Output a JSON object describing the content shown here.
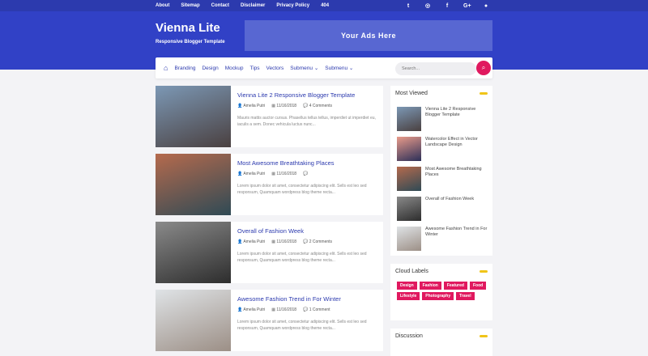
{
  "topnav": [
    "About",
    "Sitemap",
    "Contact",
    "Disclaimer",
    "Privacy Policy",
    "404"
  ],
  "social_icons": [
    {
      "name": "twitter-icon",
      "glyph": "t"
    },
    {
      "name": "instagram-icon",
      "glyph": "◎"
    },
    {
      "name": "facebook-icon",
      "glyph": "f"
    },
    {
      "name": "google-plus-icon",
      "glyph": "G+"
    },
    {
      "name": "snapchat-icon",
      "glyph": "●"
    }
  ],
  "brand": {
    "title": "Vienna Lite",
    "tagline": "Responsive Blogger Template"
  },
  "ads": {
    "label": "Your Ads Here"
  },
  "menu": {
    "home_icon": "⌂",
    "items": [
      "Branding",
      "Design",
      "Mockup",
      "Tips",
      "Vectors",
      "Submenu ⌄",
      "Submenu ⌄"
    ]
  },
  "search": {
    "placeholder": "Search..."
  },
  "posts": [
    {
      "title": "Vienna Lite 2 Responsive Blogger Template",
      "author": "Amelia Putri",
      "date": "11/16/2018",
      "comments": "4 Comments",
      "excerpt": "Mauris mattis auctor cursus. Phasellus tellus tellus, imperdiet ut imperdiet eu, iaculis a sem. Donec vehicula luctus nunc...",
      "colors": [
        "#7c98b5",
        "#4a4040"
      ]
    },
    {
      "title": "Most Awesome Breathtaking Places",
      "author": "Amelia Putri",
      "date": "11/16/2018",
      "comments": "",
      "excerpt": "Lorem ipsum dolor sit amet, consectetur adipiscing elit. Sells est leo sed responsum, Quamquam wordpress blog theme recta...",
      "colors": [
        "#b56a4d",
        "#2f4a55"
      ]
    },
    {
      "title": "Overall of Fashion Week",
      "author": "Amelia Putri",
      "date": "11/16/2018",
      "comments": "2 Comments",
      "excerpt": "Lorem ipsum dolor sit amet, consectetur adipiscing elit. Sells est leo sed responsum, Quamquam wordpress blog theme recta...",
      "colors": [
        "#8a8a8a",
        "#2d2d2d"
      ]
    },
    {
      "title": "Awesome Fashion Trend in For Winter",
      "author": "Amelia Putri",
      "date": "11/16/2018",
      "comments": "1 Comment",
      "excerpt": "Lorem ipsum dolor sit amet, consectetur adipiscing elit. Sells est leo sed responsum, Quamquam wordpress blog theme recta...",
      "colors": [
        "#dfe3e6",
        "#9c8f86"
      ]
    }
  ],
  "most_viewed": {
    "title": "Most Viewed",
    "items": [
      {
        "title": "Vienna Lite 2 Responsive Blogger Template",
        "colors": [
          "#7c98b5",
          "#4a4040"
        ]
      },
      {
        "title": "Watercolor Effect in Vector Landscape Design",
        "colors": [
          "#e99b8a",
          "#2b2f58"
        ]
      },
      {
        "title": "Most Awesome Breathtaking Places",
        "colors": [
          "#b56a4d",
          "#2f4a55"
        ]
      },
      {
        "title": "Overall of Fashion Week",
        "colors": [
          "#8a8a8a",
          "#2d2d2d"
        ]
      },
      {
        "title": "Awesome Fashion Trend in For Winter",
        "colors": [
          "#dfe3e6",
          "#9c8f86"
        ]
      }
    ]
  },
  "cloud_labels": {
    "title": "Cloud Labels",
    "labels": [
      "Design",
      "Fashion",
      "Featured",
      "Food",
      "Lifestyle",
      "Photography",
      "Travel"
    ]
  },
  "discussion": {
    "title": "Discussion"
  },
  "colors": {
    "brand_blue": "#3141c6",
    "accent_pink": "#e0195f",
    "accent_yellow": "#f0c419"
  }
}
